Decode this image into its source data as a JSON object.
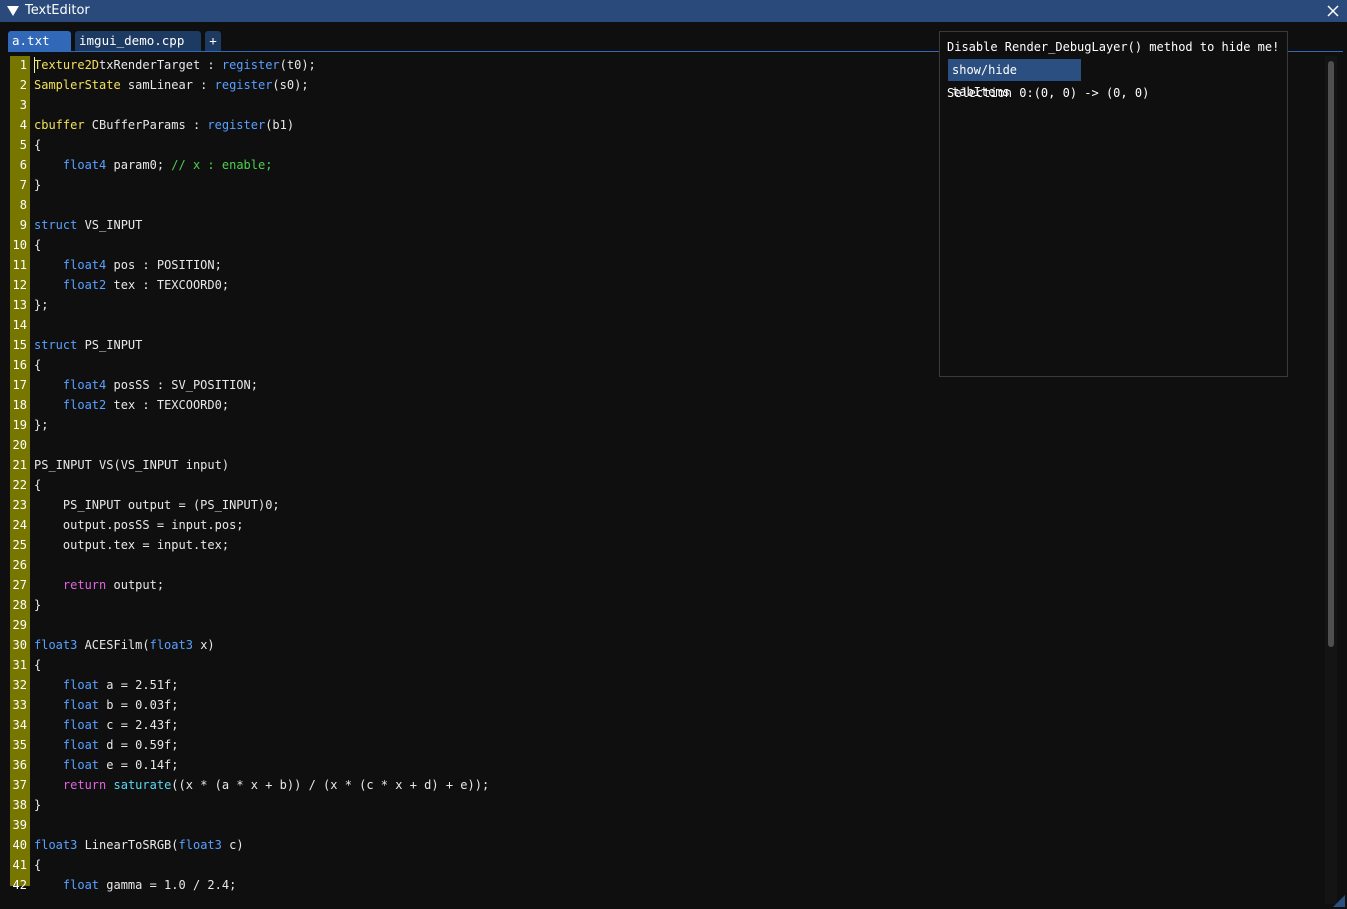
{
  "window": {
    "title": "TextEditor",
    "title_bar_color": "#294a7a"
  },
  "tabs": [
    {
      "label": "a.txt",
      "active": true
    },
    {
      "label": "imgui_demo.cpp",
      "active": false
    }
  ],
  "add_tab_label": "+",
  "debug_panel": {
    "message": "Disable Render_DebugLayer() method to hide me!",
    "button_label": "show/hide tabItems",
    "selection": "Selection 0:(0, 0) -> (0, 0)"
  },
  "editor": {
    "syntax_colors": {
      "keyword": "#5aa0ff",
      "type": "#f2e25a",
      "comment": "#4ed04e",
      "return": "#e064e0",
      "function": "#5ad8f2",
      "gutter": "#777700"
    },
    "lines": [
      {
        "n": "1",
        "segs": [
          [
            "ty",
            "Texture2D"
          ],
          [
            "",
            "txRenderTarget : "
          ],
          [
            "kw",
            "register"
          ],
          [
            "",
            "(t0);"
          ]
        ]
      },
      {
        "n": "2",
        "segs": [
          [
            "ty",
            "SamplerState"
          ],
          [
            "",
            " samLinear : "
          ],
          [
            "kw",
            "register"
          ],
          [
            "",
            "(s0);"
          ]
        ]
      },
      {
        "n": "3",
        "segs": []
      },
      {
        "n": "4",
        "segs": [
          [
            "ty",
            "cbuffer"
          ],
          [
            "",
            " CBufferParams : "
          ],
          [
            "kw",
            "register"
          ],
          [
            "",
            "(b1)"
          ]
        ]
      },
      {
        "n": "5",
        "segs": [
          [
            "",
            "{"
          ]
        ]
      },
      {
        "n": "6",
        "segs": [
          [
            "",
            "    "
          ],
          [
            "kw",
            "float4"
          ],
          [
            "",
            " param0; "
          ],
          [
            "cm",
            "// x : enable;"
          ]
        ]
      },
      {
        "n": "7",
        "segs": [
          [
            "",
            "}"
          ]
        ]
      },
      {
        "n": "8",
        "segs": []
      },
      {
        "n": "9",
        "segs": [
          [
            "kw",
            "struct"
          ],
          [
            "",
            " VS_INPUT"
          ]
        ]
      },
      {
        "n": "10",
        "segs": [
          [
            "",
            "{"
          ]
        ]
      },
      {
        "n": "11",
        "segs": [
          [
            "",
            "    "
          ],
          [
            "kw",
            "float4"
          ],
          [
            "",
            " pos : POSITION;"
          ]
        ]
      },
      {
        "n": "12",
        "segs": [
          [
            "",
            "    "
          ],
          [
            "kw",
            "float2"
          ],
          [
            "",
            " tex : TEXCOORD0;"
          ]
        ]
      },
      {
        "n": "13",
        "segs": [
          [
            "",
            "};"
          ]
        ]
      },
      {
        "n": "14",
        "segs": []
      },
      {
        "n": "15",
        "segs": [
          [
            "kw",
            "struct"
          ],
          [
            "",
            " PS_INPUT"
          ]
        ]
      },
      {
        "n": "16",
        "segs": [
          [
            "",
            "{"
          ]
        ]
      },
      {
        "n": "17",
        "segs": [
          [
            "",
            "    "
          ],
          [
            "kw",
            "float4"
          ],
          [
            "",
            " posSS : SV_POSITION;"
          ]
        ]
      },
      {
        "n": "18",
        "segs": [
          [
            "",
            "    "
          ],
          [
            "kw",
            "float2"
          ],
          [
            "",
            " tex : TEXCOORD0;"
          ]
        ]
      },
      {
        "n": "19",
        "segs": [
          [
            "",
            "};"
          ]
        ]
      },
      {
        "n": "20",
        "segs": []
      },
      {
        "n": "21",
        "segs": [
          [
            "",
            "PS_INPUT VS(VS_INPUT input)"
          ]
        ]
      },
      {
        "n": "22",
        "segs": [
          [
            "",
            "{"
          ]
        ]
      },
      {
        "n": "23",
        "segs": [
          [
            "",
            "    PS_INPUT output = (PS_INPUT)0;"
          ]
        ]
      },
      {
        "n": "24",
        "segs": [
          [
            "",
            "    output.posSS = input.pos;"
          ]
        ]
      },
      {
        "n": "25",
        "segs": [
          [
            "",
            "    output.tex = input.tex;"
          ]
        ]
      },
      {
        "n": "26",
        "segs": []
      },
      {
        "n": "27",
        "segs": [
          [
            "",
            "    "
          ],
          [
            "rt",
            "return"
          ],
          [
            "",
            " output;"
          ]
        ]
      },
      {
        "n": "28",
        "segs": [
          [
            "",
            "}"
          ]
        ]
      },
      {
        "n": "29",
        "segs": []
      },
      {
        "n": "30",
        "segs": [
          [
            "kw",
            "float3"
          ],
          [
            "",
            " ACESFilm("
          ],
          [
            "kw",
            "float3"
          ],
          [
            "",
            " x)"
          ]
        ]
      },
      {
        "n": "31",
        "segs": [
          [
            "",
            "{"
          ]
        ]
      },
      {
        "n": "32",
        "segs": [
          [
            "",
            "    "
          ],
          [
            "kw",
            "float"
          ],
          [
            "",
            " a = 2.51f;"
          ]
        ]
      },
      {
        "n": "33",
        "segs": [
          [
            "",
            "    "
          ],
          [
            "kw",
            "float"
          ],
          [
            "",
            " b = 0.03f;"
          ]
        ]
      },
      {
        "n": "34",
        "segs": [
          [
            "",
            "    "
          ],
          [
            "kw",
            "float"
          ],
          [
            "",
            " c = 2.43f;"
          ]
        ]
      },
      {
        "n": "35",
        "segs": [
          [
            "",
            "    "
          ],
          [
            "kw",
            "float"
          ],
          [
            "",
            " d = 0.59f;"
          ]
        ]
      },
      {
        "n": "36",
        "segs": [
          [
            "",
            "    "
          ],
          [
            "kw",
            "float"
          ],
          [
            "",
            " e = 0.14f;"
          ]
        ]
      },
      {
        "n": "37",
        "segs": [
          [
            "",
            "    "
          ],
          [
            "rt",
            "return"
          ],
          [
            "",
            " "
          ],
          [
            "fn",
            "saturate"
          ],
          [
            "",
            "((x * (a * x + b)) / (x * (c * x + d) + e));"
          ]
        ]
      },
      {
        "n": "38",
        "segs": [
          [
            "",
            "}"
          ]
        ]
      },
      {
        "n": "39",
        "segs": []
      },
      {
        "n": "40",
        "segs": [
          [
            "kw",
            "float3"
          ],
          [
            "",
            " LinearToSRGB("
          ],
          [
            "kw",
            "float3"
          ],
          [
            "",
            " c)"
          ]
        ]
      },
      {
        "n": "41",
        "segs": [
          [
            "",
            "{"
          ]
        ]
      },
      {
        "n": "42",
        "segs": [
          [
            "",
            "    "
          ],
          [
            "kw",
            "float"
          ],
          [
            "",
            " gamma = 1.0 / 2.4;"
          ]
        ]
      }
    ]
  }
}
